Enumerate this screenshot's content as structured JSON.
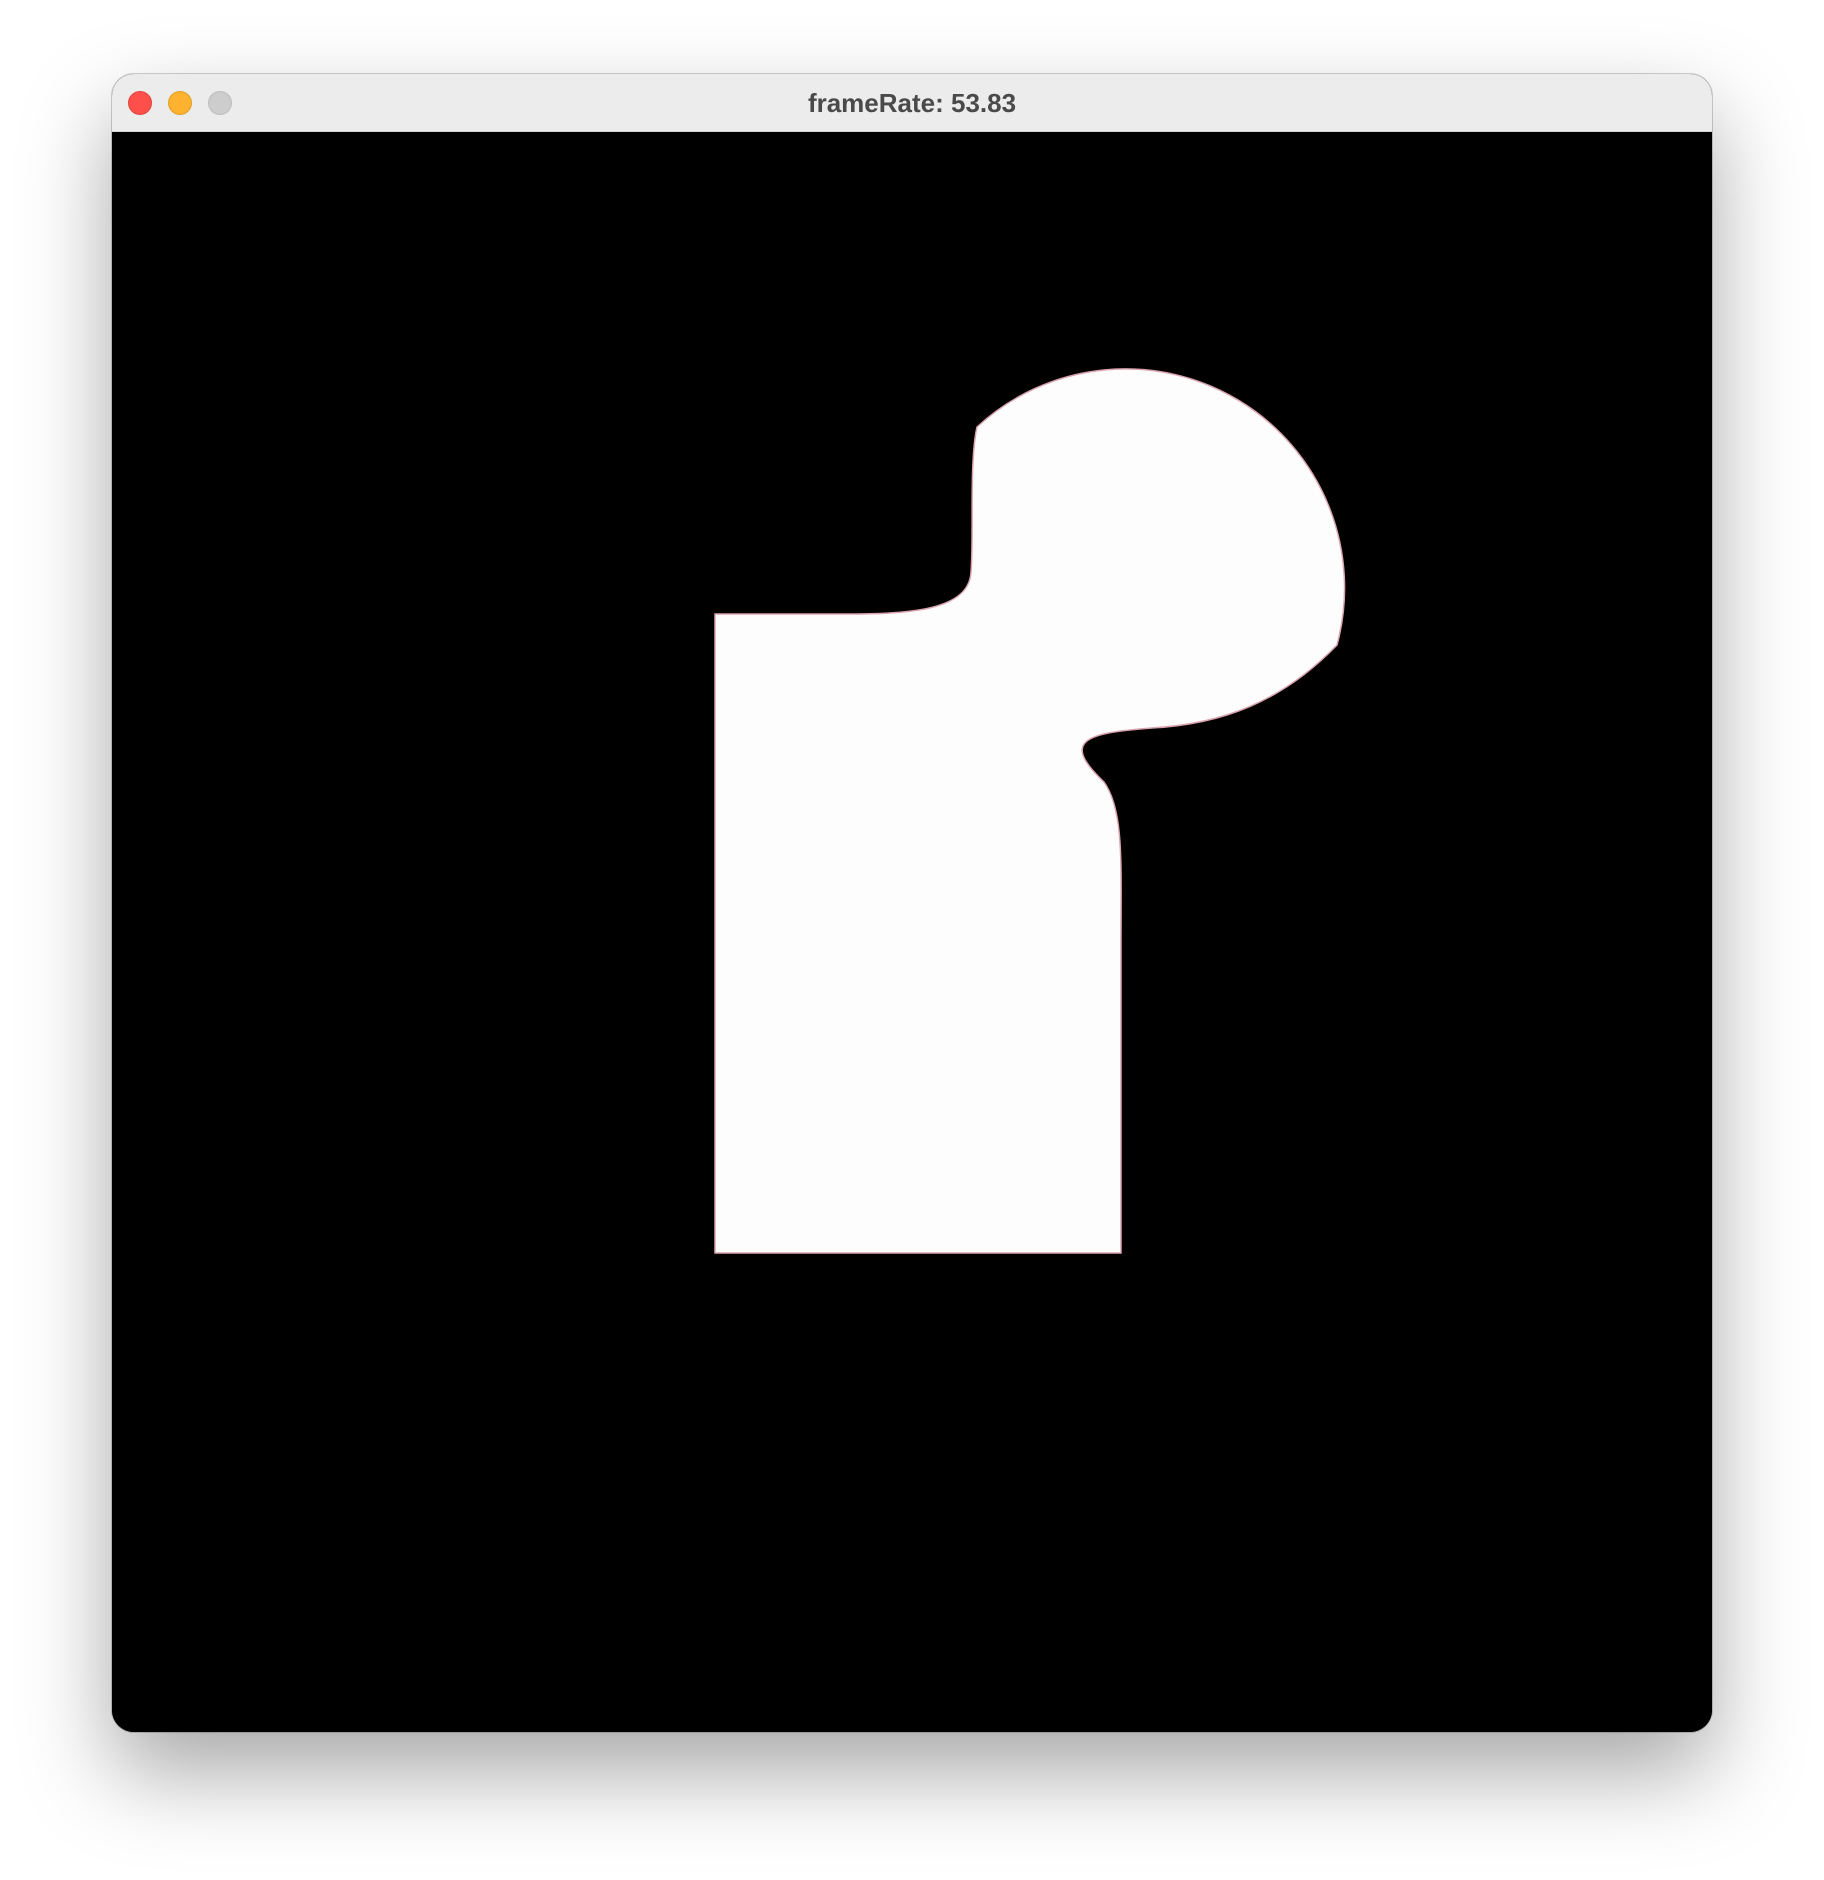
{
  "window": {
    "title": "frameRate: 53.83"
  },
  "colors": {
    "canvas_background": "#000000",
    "shape_fill": "#fdfdfd",
    "shape_stroke": "#d9a3b0",
    "titlebar": "#ececec",
    "close": "#fe4f4a",
    "minimize": "#feb22f",
    "zoom": "#cdcdcd"
  },
  "icons": {
    "close": "close-button-icon",
    "minimize": "minimize-button-icon",
    "zoom": "zoom-button-icon"
  }
}
